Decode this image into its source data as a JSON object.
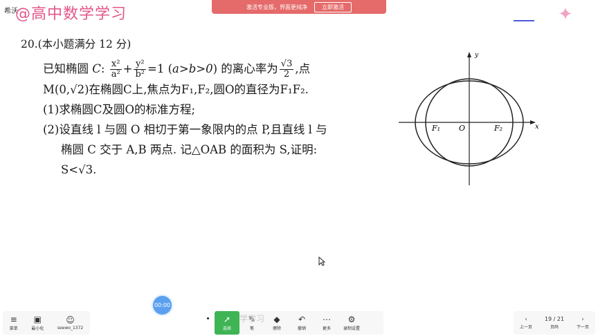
{
  "app": {
    "label": "希沃",
    "watermark": "@高中数学学习"
  },
  "banner": {
    "text": "激活专业版，界面更纯净",
    "button": "立即激活"
  },
  "problem": {
    "number": "20.",
    "header": "(本小题满分 12 分)",
    "l1_a": "已知椭圆 ",
    "l1_C": "C",
    "l1_colon": ":",
    "f1_num": "x²",
    "f1_den": "a²",
    "l1_plus": "+",
    "f2_num": "y²",
    "f2_den": "b²",
    "l1_eq": "=1 (",
    "l1_cond": "a>b>0",
    "l1_b": ") 的离心率为",
    "f3_num": "√3",
    "f3_den": "2",
    "l1_end": ",点",
    "l2": "M(0,√2)在椭圆C上,焦点为F₁,F₂,圆O的直径为F₁F₂.",
    "q1": "(1)求椭圆C及圆O的标准方程;",
    "q2a": "(2)设直线 l 与圆 O 相切于第一象限内的点 P,且直线 l 与",
    "q2b": "椭圆 C 交于 A,B 两点. 记△OAB 的面积为 S,证明:",
    "q2c": "S<√3."
  },
  "diagram": {
    "x_label": "x",
    "y_label": "y",
    "origin": "O",
    "f1": "F₁",
    "f2": "F₂"
  },
  "toolbar_left": [
    {
      "icon": "menu-icon",
      "glyph": "≡",
      "label": "菜单"
    },
    {
      "icon": "minimize-icon",
      "glyph": "▣",
      "label": "最小化"
    },
    {
      "icon": "avatar-icon",
      "glyph": "☺",
      "label": "seewo_1372"
    }
  ],
  "timer": "00:00",
  "toolbar_mid": [
    {
      "icon": "select-icon",
      "glyph": "➚",
      "label": "选择"
    },
    {
      "icon": "pen-icon",
      "glyph": "✎",
      "label": "笔"
    },
    {
      "icon": "eraser-icon",
      "glyph": "◆",
      "label": "擦除"
    },
    {
      "icon": "undo-icon",
      "glyph": "↶",
      "label": "撤销"
    },
    {
      "icon": "more-icon",
      "glyph": "⋯",
      "label": "更多"
    },
    {
      "icon": "record-settings-icon",
      "glyph": "⚙",
      "label": "录制设置"
    }
  ],
  "faint_mark": "学学习",
  "pager": {
    "prev": "上一页",
    "page_label": "页码",
    "page": "19 / 21",
    "next": "下一页"
  },
  "colors": {
    "banner": "#e56a6a",
    "active_tool": "#3fb454",
    "watermark": "#e3568a",
    "timer": "#5aa0ef"
  }
}
